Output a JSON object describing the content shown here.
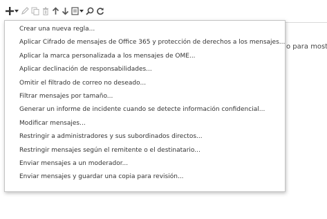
{
  "toolbar": {
    "icons": [
      "plus-icon",
      "pencil-icon",
      "copy-icon",
      "trash-icon",
      "arrow-up-icon",
      "arrow-down-icon",
      "report-icon",
      "search-icon",
      "refresh-icon"
    ]
  },
  "background": {
    "partial_text": "o para mostra"
  },
  "menu": {
    "items": [
      {
        "label": "Crear una nueva regla..."
      },
      {
        "label": "Aplicar Cifrado de mensajes de Office 365 y protección de derechos a los mensajes..."
      },
      {
        "label": "Aplicar la marca personalizada a los mensajes de OME..."
      },
      {
        "label": "Aplicar declinación de responsabilidades..."
      },
      {
        "label": "Omitir el filtrado de correo no deseado..."
      },
      {
        "label": "Filtrar mensajes por tamaño..."
      },
      {
        "label": "Generar un informe de incidente cuando se detecte información confidencial..."
      },
      {
        "label": "Modificar mensajes..."
      },
      {
        "label": "Restringir a administradores y sus subordinados directos..."
      },
      {
        "label": "Restringir mensajes según el remitente o el destinatario..."
      },
      {
        "label": "Enviar mensajes a un moderador..."
      },
      {
        "label": "Enviar mensajes y guardar una copia para revisión..."
      }
    ]
  }
}
